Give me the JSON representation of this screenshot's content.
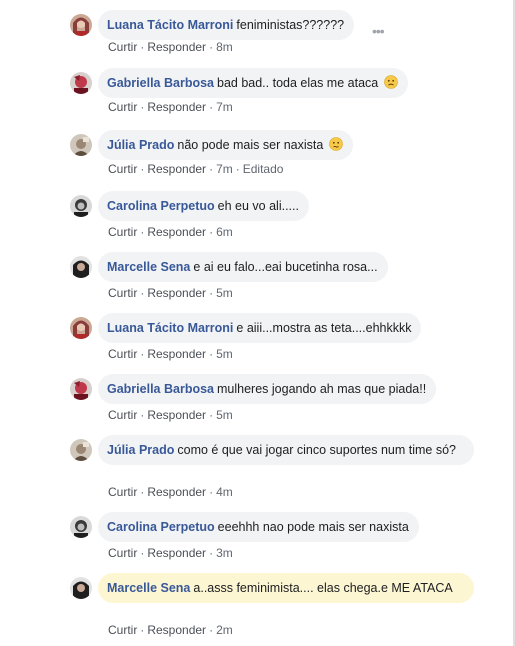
{
  "comments": [
    {
      "author": "Luana Tácito Marroni",
      "text": "feniministas??????",
      "like": "Curtir",
      "reply": "Responder",
      "time": "8m",
      "edited": "",
      "emoji": "",
      "avatar_color": "#8a3b3b"
    },
    {
      "author": "Gabriella Barbosa",
      "text": "bad bad.. toda elas me ataca",
      "like": "Curtir",
      "reply": "Responder",
      "time": "7m",
      "edited": "",
      "emoji": "sad-face-icon",
      "avatar_color": "#a0283a"
    },
    {
      "author": "Júlia Prado",
      "text": "não pode mais ser naxista",
      "like": "Curtir",
      "reply": "Responder",
      "time": "7m",
      "edited": "Editado",
      "emoji": "confused-face-icon",
      "avatar_color": "#7a6a58"
    },
    {
      "author": "Carolina Perpetuo",
      "text": "eh eu vo ali.....",
      "like": "Curtir",
      "reply": "Responder",
      "time": "6m",
      "edited": "",
      "emoji": "",
      "avatar_color": "#3a3a3a"
    },
    {
      "author": "Marcelle Sena",
      "text": "e ai eu falo...eai bucetinha rosa...",
      "like": "Curtir",
      "reply": "Responder",
      "time": "5m",
      "edited": "",
      "emoji": "",
      "avatar_color": "#2b2b2b"
    },
    {
      "author": "Luana Tácito Marroni",
      "text": "e aiii...mostra as teta....ehhkkkk",
      "like": "Curtir",
      "reply": "Responder",
      "time": "5m",
      "edited": "",
      "emoji": "",
      "avatar_color": "#8a3b3b"
    },
    {
      "author": "Gabriella Barbosa",
      "text": "mulheres jogando ah mas que piada!!",
      "like": "Curtir",
      "reply": "Responder",
      "time": "5m",
      "edited": "",
      "emoji": "",
      "avatar_color": "#a0283a"
    },
    {
      "author": "Júlia Prado",
      "text": "como é que vai jogar cinco suportes num time só?",
      "like": "Curtir",
      "reply": "Responder",
      "time": "4m",
      "edited": "",
      "emoji": "",
      "avatar_color": "#7a6a58"
    },
    {
      "author": "Carolina Perpetuo",
      "text": "eeehhh nao pode mais ser naxista",
      "like": "Curtir",
      "reply": "Responder",
      "time": "3m",
      "edited": "",
      "emoji": "",
      "avatar_color": "#3a3a3a"
    },
    {
      "author": "Marcelle Sena",
      "text": "a..asss feminimista.... elas chega.e ME ATACA",
      "like": "Curtir",
      "reply": "Responder",
      "time": "2m",
      "edited": "",
      "emoji": "",
      "avatar_color": "#2b2b2b",
      "highlighted": true
    }
  ],
  "more_options_icon": "more-dots-icon",
  "colors": {
    "author": "#385898",
    "bubble": "#f2f3f5",
    "highlight_bubble": "#fdf6d3",
    "meta": "#606770"
  }
}
